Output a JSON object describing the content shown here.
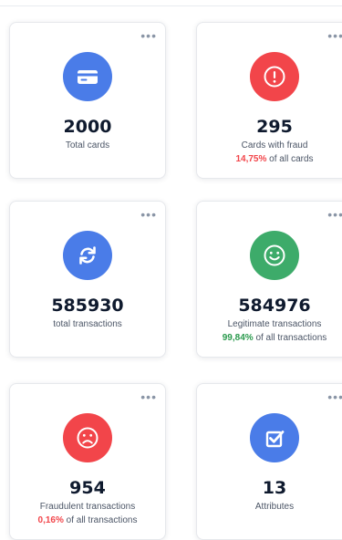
{
  "more_label": "•••",
  "cards": [
    {
      "value": "2000",
      "label": "Total cards",
      "icon": "credit-card-icon",
      "icon_color": "#4a7ce8"
    },
    {
      "value": "295",
      "label": "Cards with fraud",
      "icon": "alert-icon",
      "icon_color": "#f2454a",
      "percent": "14,75%",
      "percent_color": "#f2454a",
      "suffix": "of all cards"
    },
    {
      "value": "585930",
      "label": "total transactions",
      "icon": "refresh-icon",
      "icon_color": "#4a7ce8"
    },
    {
      "value": "584976",
      "label": "Legitimate transactions",
      "icon": "smile-icon",
      "icon_color": "#3dab6a",
      "percent": "99,84%",
      "percent_color": "#2a9a4d",
      "suffix": "of all transactions"
    },
    {
      "value": "954",
      "label": "Fraudulent transactions",
      "icon": "sad-face-icon",
      "icon_color": "#f2454a",
      "percent": "0,16%",
      "percent_color": "#f2454a",
      "suffix": "of all transactions"
    },
    {
      "value": "13",
      "label": "Attributes",
      "icon": "checkbox-icon",
      "icon_color": "#4a7ce8"
    }
  ]
}
